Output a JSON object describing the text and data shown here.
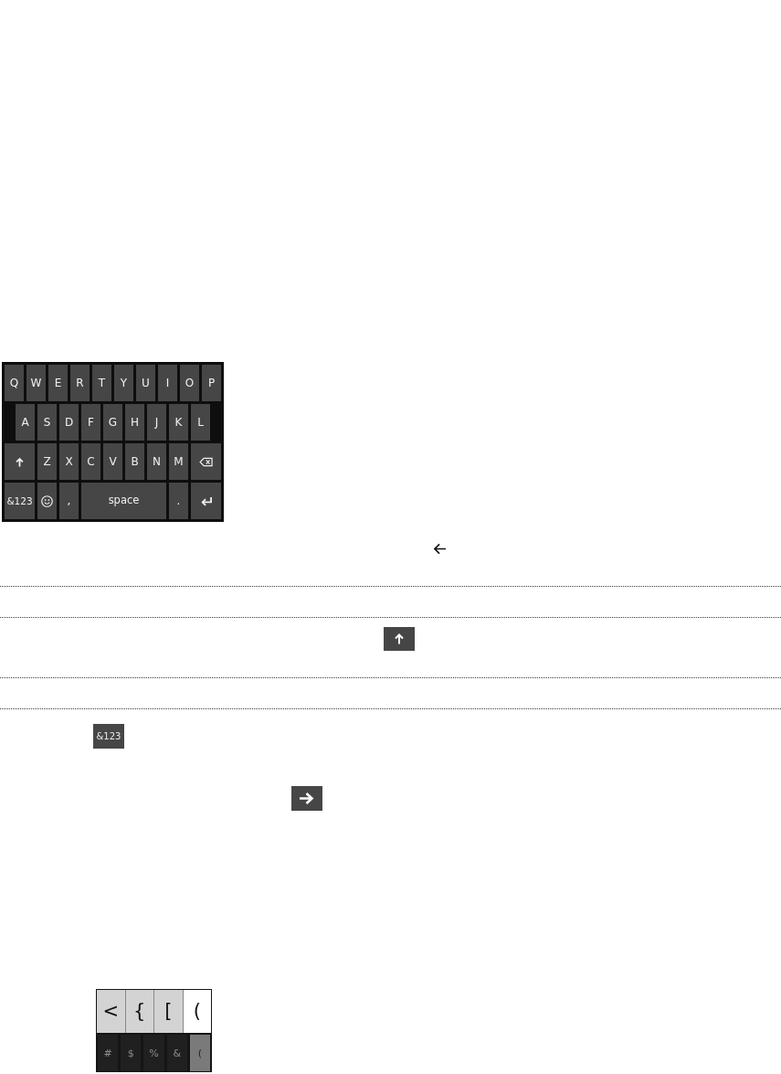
{
  "keyboard": {
    "rows": [
      {
        "keys": [
          {
            "kind": "char",
            "label": "Q"
          },
          {
            "kind": "char",
            "label": "W"
          },
          {
            "kind": "char",
            "label": "E"
          },
          {
            "kind": "char",
            "label": "R"
          },
          {
            "kind": "char",
            "label": "T"
          },
          {
            "kind": "char",
            "label": "Y"
          },
          {
            "kind": "char",
            "label": "U"
          },
          {
            "kind": "char",
            "label": "I"
          },
          {
            "kind": "char",
            "label": "O"
          },
          {
            "kind": "char",
            "label": "P"
          }
        ]
      },
      {
        "keys": [
          {
            "kind": "char",
            "label": "A"
          },
          {
            "kind": "char",
            "label": "S"
          },
          {
            "kind": "char",
            "label": "D"
          },
          {
            "kind": "char",
            "label": "F"
          },
          {
            "kind": "char",
            "label": "G"
          },
          {
            "kind": "char",
            "label": "H"
          },
          {
            "kind": "char",
            "label": "J"
          },
          {
            "kind": "char",
            "label": "K"
          },
          {
            "kind": "char",
            "label": "L"
          }
        ]
      },
      {
        "keys": [
          {
            "kind": "shift"
          },
          {
            "kind": "char",
            "label": "Z"
          },
          {
            "kind": "char",
            "label": "X"
          },
          {
            "kind": "char",
            "label": "C"
          },
          {
            "kind": "char",
            "label": "V"
          },
          {
            "kind": "char",
            "label": "B"
          },
          {
            "kind": "char",
            "label": "N"
          },
          {
            "kind": "char",
            "label": "M"
          },
          {
            "kind": "backspace"
          }
        ]
      },
      {
        "keys": [
          {
            "kind": "symbols",
            "label": "&123"
          },
          {
            "kind": "emoji"
          },
          {
            "kind": "char",
            "label": ","
          },
          {
            "kind": "space",
            "label": "space"
          },
          {
            "kind": "char",
            "label": "."
          },
          {
            "kind": "enter"
          }
        ]
      }
    ]
  },
  "symbols_key": {
    "label": "&123"
  },
  "symbol_keyboard": {
    "alternates": [
      {
        "label": "<",
        "selected": false
      },
      {
        "label": "{",
        "selected": false
      },
      {
        "label": "[",
        "selected": false
      },
      {
        "label": "(",
        "selected": true
      }
    ],
    "keys": [
      {
        "label": "#",
        "selected": false
      },
      {
        "label": "$",
        "selected": false
      },
      {
        "label": "%",
        "selected": false
      },
      {
        "label": "&",
        "selected": false
      },
      {
        "label": "(",
        "selected": true
      }
    ]
  }
}
